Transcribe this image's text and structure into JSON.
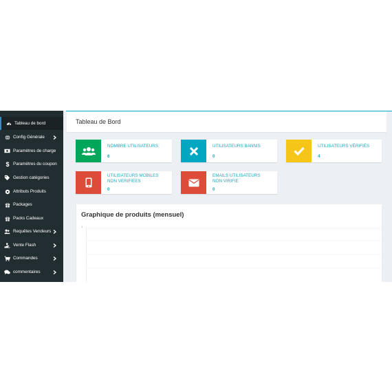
{
  "sidebar": {
    "items": [
      {
        "label": "Tableau de bord",
        "icon": "dashboard-icon",
        "active": true,
        "submenu": false
      },
      {
        "label": "Config Générale",
        "icon": "globe-icon",
        "active": false,
        "submenu": true
      },
      {
        "label": "Paramètres de charge",
        "icon": "money-icon",
        "active": false,
        "submenu": false
      },
      {
        "label": "Paramètres du coupon",
        "icon": "dollar-icon",
        "active": false,
        "submenu": false
      },
      {
        "label": "Gestion catégories",
        "icon": "tags-icon",
        "active": false,
        "submenu": false
      },
      {
        "label": "Attributs Produits",
        "icon": "circle-icon",
        "active": false,
        "submenu": false
      },
      {
        "label": "Packages",
        "icon": "gift-icon",
        "active": false,
        "submenu": false
      },
      {
        "label": "Packs Cadeaux",
        "icon": "gift-icon",
        "active": false,
        "submenu": false
      },
      {
        "label": "Requêtes Vendeurs",
        "icon": "users-icon",
        "active": false,
        "submenu": true
      },
      {
        "label": "Vente Flash",
        "icon": "hand-icon",
        "active": false,
        "submenu": true
      },
      {
        "label": "Commandes",
        "icon": "cart-icon",
        "active": false,
        "submenu": true
      },
      {
        "label": "commentaires",
        "icon": "comments-icon",
        "active": false,
        "submenu": true
      }
    ]
  },
  "header": {
    "title": "Tableau de Bord"
  },
  "stats": [
    {
      "label": "NOMBRE UTILISATEURS",
      "value": "6",
      "icon": "users-icon",
      "color": "#00a65a"
    },
    {
      "label": "UTILISATEURS BANNIS",
      "value": "0",
      "icon": "times-icon",
      "color": "#00a7c0"
    },
    {
      "label": "UTILISATEURS VÉRIFIÉS",
      "value": "4",
      "icon": "check-icon",
      "color": "#f5c517"
    },
    {
      "label": "UTILISATEURS MOBILES NON VERIFIEES",
      "line1": "UTILISATEURS MOBILES",
      "line2": "NON VERIFIEES",
      "value": "0",
      "icon": "mobile-icon",
      "color": "#dd4b39"
    },
    {
      "label": "EMAILS UTILISATEURS NON VIRIFIE",
      "line1": "EMAILS UTILISATEURS",
      "line2": "NON VIRIFIE",
      "value": "0",
      "icon": "envelope-icon",
      "color": "#dd4b39"
    }
  ],
  "chart": {
    "title": "Graphique de produits (mensuel)",
    "y_tick": "1"
  },
  "chart_data": {
    "type": "line",
    "title": "Graphique de produits (mensuel)",
    "xlabel": "",
    "ylabel": "",
    "yticks": [
      "1"
    ],
    "grid": true,
    "series": []
  },
  "colors": {
    "sidebar_bg": "#222d32",
    "accent": "#1ba8bf",
    "green": "#00a65a",
    "teal": "#00a7c0",
    "yellow": "#f5c517",
    "red": "#dd4b39"
  }
}
